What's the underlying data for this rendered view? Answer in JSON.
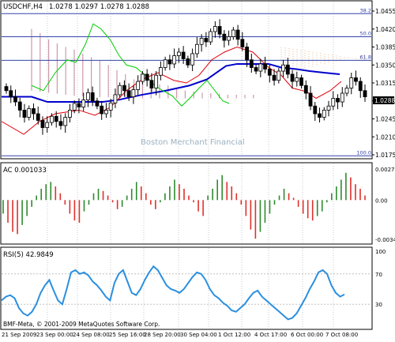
{
  "main": {
    "symbol_line": "USDCHF,H4",
    "ohlc": "1.0278 1.0297 1.0278 1.0288",
    "watermark": "Boston Merchant Financial",
    "price_ticks": [
      "1.0455",
      "1.0420",
      "1.0385",
      "1.0350",
      "1.0315",
      "1.0280",
      "1.0245",
      "1.0210",
      "1.0175"
    ],
    "current_price": "1.0288",
    "fib_levels": [
      {
        "label": "38.2",
        "price": 1.045
      },
      {
        "label": "50.0",
        "price": 1.0405
      },
      {
        "label": "61.8",
        "price": 1.0359
      },
      {
        "label": "100.0",
        "price": 1.0173
      }
    ],
    "colors": {
      "bull_candle": "#ffffff",
      "bear_candle": "#000000",
      "kijun": "#0000cc",
      "tenkan": "#e0000a",
      "chikou": "#00cc00",
      "cloud": "#cc99aa",
      "fib": "#3344aa",
      "grid": "#c8c8c8"
    }
  },
  "ac": {
    "label": "AC 0.001033",
    "ticks": [
      "0.002736",
      "0.00",
      "-0.00346"
    ],
    "colors": {
      "up": "#2e8b2e",
      "down": "#e0302a"
    }
  },
  "rsi": {
    "label": "RSI(5) 42.9849",
    "ticks": [
      "100",
      "70",
      "30",
      "0"
    ],
    "line_color": "#2a8fe0"
  },
  "footer": {
    "copyright": "BMF-Meta, © 2001-2009 MetaQuotes Software Corp."
  },
  "time_axis": [
    "21 Sep 2009",
    "23 Sep 00:00",
    "24 Sep 08:00",
    "25 Sep 16:00",
    "28 Sep 20:00",
    "30 Sep 04:00",
    "1 Oct 12:00",
    "4 Oct 17:00",
    "6 Oct 00:00",
    "7 Oct 08:00"
  ]
}
